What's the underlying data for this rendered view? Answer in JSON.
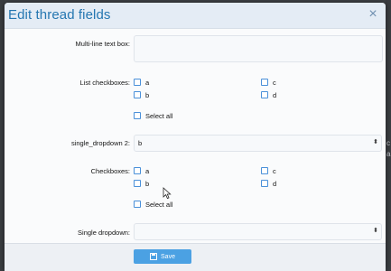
{
  "backdrop": {
    "fragments": [
      "c",
      "a"
    ]
  },
  "modal": {
    "title": "Edit thread fields",
    "close_icon": "×"
  },
  "fields": {
    "multiline": {
      "label": "Multi-line text box:",
      "value": ""
    },
    "list_checkboxes": {
      "label": "List checkboxes:",
      "options": [
        "a",
        "c",
        "b",
        "d"
      ],
      "select_all": "Select all"
    },
    "single_dropdown_2": {
      "label": "single_dropdown 2:",
      "value": "b",
      "caret": "⬍"
    },
    "checkboxes": {
      "label": "Checkboxes:",
      "options": [
        "a",
        "c",
        "b",
        "d"
      ],
      "select_all": "Select all"
    },
    "single_dropdown": {
      "label": "Single dropdown:",
      "value": "",
      "caret": "⬍"
    }
  },
  "footer": {
    "save_label": "Save"
  },
  "colors": {
    "title": "#2577b1",
    "button": "#4ba1e3",
    "checkbox_border": "#4a90d9"
  }
}
